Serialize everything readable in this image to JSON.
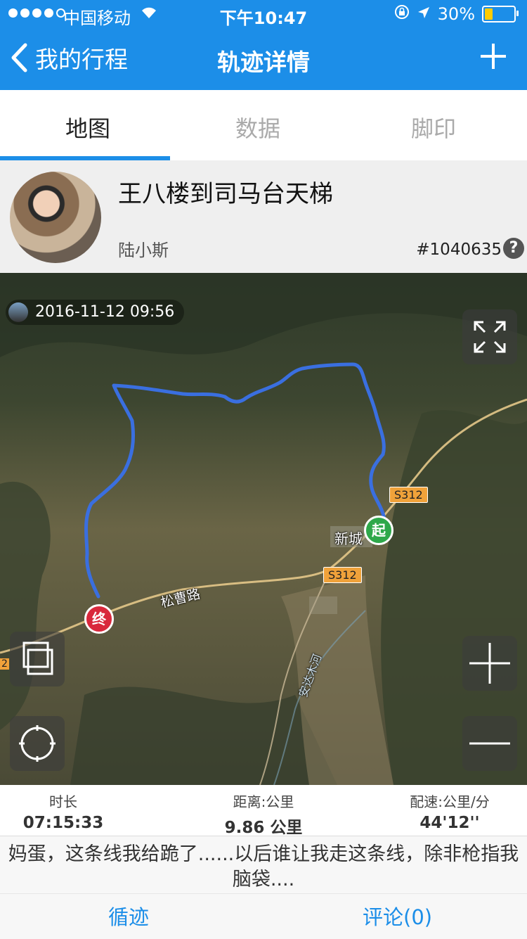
{
  "status_bar": {
    "carrier": "中国移动",
    "time": "下午10:47",
    "battery": "30%",
    "battery_level": 0.3
  },
  "nav": {
    "back_label": "我的行程",
    "title": "轨迹详情"
  },
  "tabs": [
    {
      "label": "地图",
      "active": true
    },
    {
      "label": "数据",
      "active": false
    },
    {
      "label": "脚印",
      "active": false
    }
  ],
  "profile": {
    "route_title": "王八楼到司马台天梯",
    "author": "陆小斯",
    "track_id": "#1040635",
    "help": "?"
  },
  "map": {
    "timestamp": "2016-11-12 09:56",
    "road_labels": [
      "S312",
      "S312"
    ],
    "road_name": "松曹路",
    "edge_label": "2",
    "place_name": "新城",
    "river_name": "安达木河",
    "start_marker": "起",
    "end_marker": "终",
    "route_color": "#3a6fe0"
  },
  "stats": {
    "duration_label": "时长",
    "duration_value": "07:15:33",
    "distance_label": "距离:公里",
    "distance_value": "9.86 公里",
    "pace_label": "配速:公里/分",
    "pace_value": "44'12''"
  },
  "comment": "妈蛋，这条线我给跪了......以后谁让我走这条线，除非枪指我脑袋....",
  "actions": {
    "follow_label": "循迹",
    "comments_label": "评论(0)"
  },
  "colors": {
    "brand": "#1c8ee8",
    "start": "#2ea84a",
    "end": "#d9283c"
  }
}
